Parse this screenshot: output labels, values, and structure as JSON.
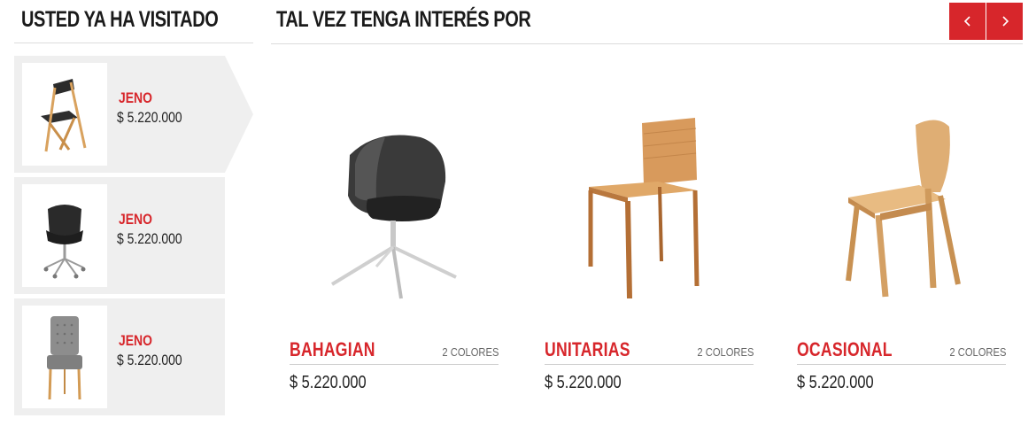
{
  "visited": {
    "title": "USTED YA HA VISITADO",
    "items": [
      {
        "name": "JENO",
        "price": "$ 5.220.000",
        "image": "folding-wood-chair-icon"
      },
      {
        "name": "JENO",
        "price": "$ 5.220.000",
        "image": "swivel-chair-icon"
      },
      {
        "name": "JENO",
        "price": "$ 5.220.000",
        "image": "upholstered-chair-icon"
      }
    ]
  },
  "interest": {
    "title": "TAL VEZ TENGA INTERÉS POR",
    "prev_icon": "chevron-left-icon",
    "next_icon": "chevron-right-icon",
    "products": [
      {
        "name": "BAHAGIAN",
        "colors": "2 COLORES",
        "price": "$ 5.220.000",
        "image": "shell-armchair-icon"
      },
      {
        "name": "UNITARIAS",
        "colors": "2 COLORES",
        "price": "$ 5.220.000",
        "image": "wood-chair-icon"
      },
      {
        "name": "OCASIONAL",
        "colors": "2 COLORES",
        "price": "$ 5.220.000",
        "image": "plywood-chair-icon"
      }
    ]
  },
  "colors": {
    "accent": "#d7262b",
    "panel": "#efefef",
    "rule": "#dcdcdc"
  }
}
